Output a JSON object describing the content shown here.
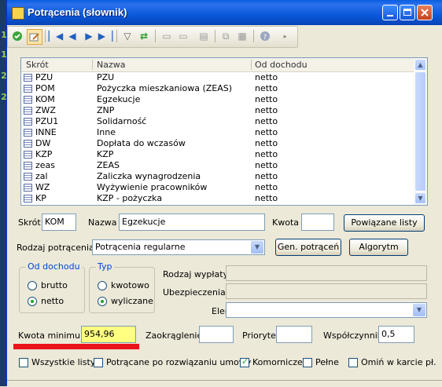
{
  "window": {
    "title": "Potrącenia (słownik)"
  },
  "background_strip": {
    "numbers": [
      "1",
      "1",
      "2",
      "2"
    ]
  },
  "list": {
    "columns": [
      "Skrót",
      "Nazwa",
      "Od dochodu"
    ],
    "rows": [
      {
        "skrot": "PZU",
        "nazwa": "PZU",
        "od_dochodu": "netto"
      },
      {
        "skrot": "POM",
        "nazwa": "Pożyczka mieszkaniowa (ZEAS)",
        "od_dochodu": "netto"
      },
      {
        "skrot": "KOM",
        "nazwa": "Egzekucje",
        "od_dochodu": "netto"
      },
      {
        "skrot": "ZWZ",
        "nazwa": "ZNP",
        "od_dochodu": "netto"
      },
      {
        "skrot": "PZU1",
        "nazwa": "Solidarność",
        "od_dochodu": "netto"
      },
      {
        "skrot": "INNE",
        "nazwa": "Inne",
        "od_dochodu": "netto"
      },
      {
        "skrot": "DW",
        "nazwa": "Dopłata do wczasów",
        "od_dochodu": "netto"
      },
      {
        "skrot": "KZP",
        "nazwa": "KZP",
        "od_dochodu": "netto"
      },
      {
        "skrot": "zeas",
        "nazwa": "ZEAS",
        "od_dochodu": "netto"
      },
      {
        "skrot": "zal",
        "nazwa": "Zaliczka wynagrodzenia",
        "od_dochodu": "netto"
      },
      {
        "skrot": "WZ",
        "nazwa": "Wyżywienie pracowników",
        "od_dochodu": "netto"
      },
      {
        "skrot": "KP",
        "nazwa": "KZP - pożyczka",
        "od_dochodu": "netto"
      }
    ]
  },
  "form": {
    "skrot_label": "Skrót",
    "skrot_value": "KOM",
    "nazwa_label": "Nazwa",
    "nazwa_value": "Egzekucje",
    "kwota_label": "Kwota",
    "kwota_value": "",
    "powiazane_button": "Powiązane listy",
    "rodzaj_label": "Rodzaj potrącenia:",
    "rodzaj_value": "Potrącenia regularne",
    "gen_button": "Gen. potrąceń",
    "algorytm_button": "Algorytm",
    "od_dochodu_group": {
      "title": "Od dochodu",
      "options": [
        "brutto",
        "netto"
      ],
      "selected": "netto"
    },
    "typ_group": {
      "title": "Typ",
      "options": [
        "kwotowo",
        "wyliczane"
      ],
      "selected": "wyliczane"
    },
    "rodzaj_wyplaty_label": "Rodzaj wypłaty",
    "ubezpieczenia_label": "Ubezpieczenia",
    "element_label": "Element",
    "kwota_minimum_label": "Kwota minimum",
    "kwota_minimum_value": "954,96",
    "zaokraglenie_label": "Zaokrąglenie",
    "priorytet_label": "Priorytet",
    "wspolczynnik_label": "Współczynnik",
    "wspolczynnik_value": "0,5",
    "checkboxes": [
      {
        "label": "Wszystkie listy",
        "checked": false
      },
      {
        "label": "Potrącane po rozwiązaniu umowy",
        "checked": false
      },
      {
        "label": "Komornicze",
        "checked": true
      },
      {
        "label": "Pełne",
        "checked": false
      },
      {
        "label": "Omiń w karcie pł.",
        "checked": false
      }
    ]
  },
  "toolbar": {
    "icons": [
      "check-icon",
      "edit-icon",
      "first-icon",
      "prev-icon",
      "next-icon",
      "last-icon",
      "filter-icon",
      "refresh-icon",
      "print-icon",
      "print-preview-icon",
      "copy-icon",
      "paste-icon",
      "help-icon",
      "overflow-icon"
    ]
  },
  "colors": {
    "titlebar": "#0a5ee0",
    "highlight_field": "#ffff80",
    "red_mark": "#e8141a",
    "accent": "#0046d5"
  }
}
